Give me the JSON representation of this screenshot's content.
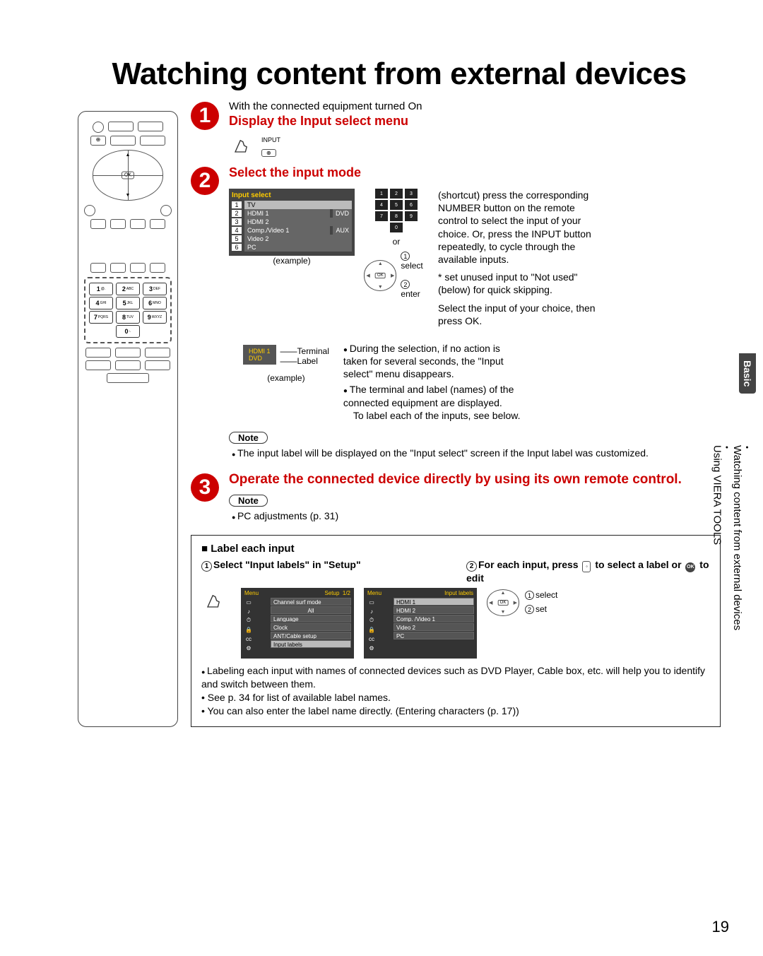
{
  "page_title": "Watching content from external devices",
  "page_number": "19",
  "side_tab": "Basic",
  "side_breadcrumb": {
    "a": "Watching content from external devices",
    "b": "Using VIERA TOOLS"
  },
  "remote": {
    "input_label": "⊕",
    "ok": "OK",
    "num": [
      "1 @.",
      "2 ABC",
      "3 DEF",
      "4 GHI",
      "5 JKL",
      "6 MNO",
      "7 PQRS",
      "8 TUV",
      "9 WXYZ",
      "0 - ."
    ]
  },
  "step1": {
    "num": "1",
    "intro": "With the connected equipment turned On",
    "title": "Display the Input select menu",
    "button_label": "INPUT"
  },
  "step2": {
    "num": "2",
    "title": "Select the input mode",
    "osd_title": "Input select",
    "osd_items": [
      {
        "idx": "1",
        "label": "TV",
        "tag": ""
      },
      {
        "idx": "2",
        "label": "HDMI 1",
        "tag": "DVD"
      },
      {
        "idx": "3",
        "label": "HDMI 2",
        "tag": ""
      },
      {
        "idx": "4",
        "label": "Comp./Video 1",
        "tag": "AUX"
      },
      {
        "idx": "5",
        "label": "Video 2",
        "tag": ""
      },
      {
        "idx": "6",
        "label": "PC",
        "tag": ""
      }
    ],
    "example": "(example)",
    "keypad": [
      "1@.",
      "2ABC",
      "3DEF",
      "4GHI",
      "5JKL",
      "6MNO",
      "7PQRS",
      "8TUV",
      "9WXYZ",
      "0-."
    ],
    "or": "or",
    "legend_select": "select",
    "legend_enter": "enter",
    "right_paras": {
      "p1": "(shortcut) press the corresponding NUMBER button on the remote control to select the input of your choice. Or, press the INPUT button repeatedly, to cycle through the available inputs.",
      "p2": "* set unused input to \"Not used\" (below) for quick skipping.",
      "p3": "Select the input of your choice, then press OK."
    },
    "right_bullets": [
      "During the selection, if no action is taken for several seconds, the \"Input select\" menu disappears.",
      "The terminal and label (names) of the connected equipment are displayed.",
      "To label each of the inputs, see below."
    ],
    "screen_ex": {
      "terminal": "HDMI 1",
      "label": "DVD",
      "t_cap": "Terminal",
      "l_cap": "Label"
    },
    "note_title": "Note",
    "note_text": "The input label will be displayed on the \"Input select\" screen if the Input label was customized."
  },
  "step3": {
    "num": "3",
    "title": "Operate the connected device directly by using its own remote control.",
    "note_title": "Note",
    "note_text": "PC adjustments (p. 31)"
  },
  "labelbox": {
    "title": "Label each input",
    "left_h": "Select \"Input labels\" in \"Setup\"",
    "right_h_a": "For each input, press ",
    "right_h_b": " to select a label or ",
    "right_h_c": " to edit",
    "menu_a": {
      "hdr_l": "Menu",
      "hdr_r": "Setup",
      "page": "1/2",
      "items": [
        "Channel surf mode",
        "All",
        "Language",
        "Clock",
        "ANT/Cable setup",
        "Input labels"
      ]
    },
    "menu_b": {
      "hdr_l": "Menu",
      "hdr_r": "Input labels",
      "items": [
        "HDMI 1",
        "HDMI 2",
        "Comp. /Video 1",
        "Video 2",
        "PC"
      ]
    },
    "leg_select": "select",
    "leg_set": "set",
    "footer": {
      "b1": "Labeling each input with names of connected devices such as DVD Player, Cable box, etc. will help you to identify and switch between them.",
      "d1": "See p. 34 for list of available label names.",
      "d2": "You can also enter the label name directly. (Entering characters (p. 17))"
    }
  }
}
